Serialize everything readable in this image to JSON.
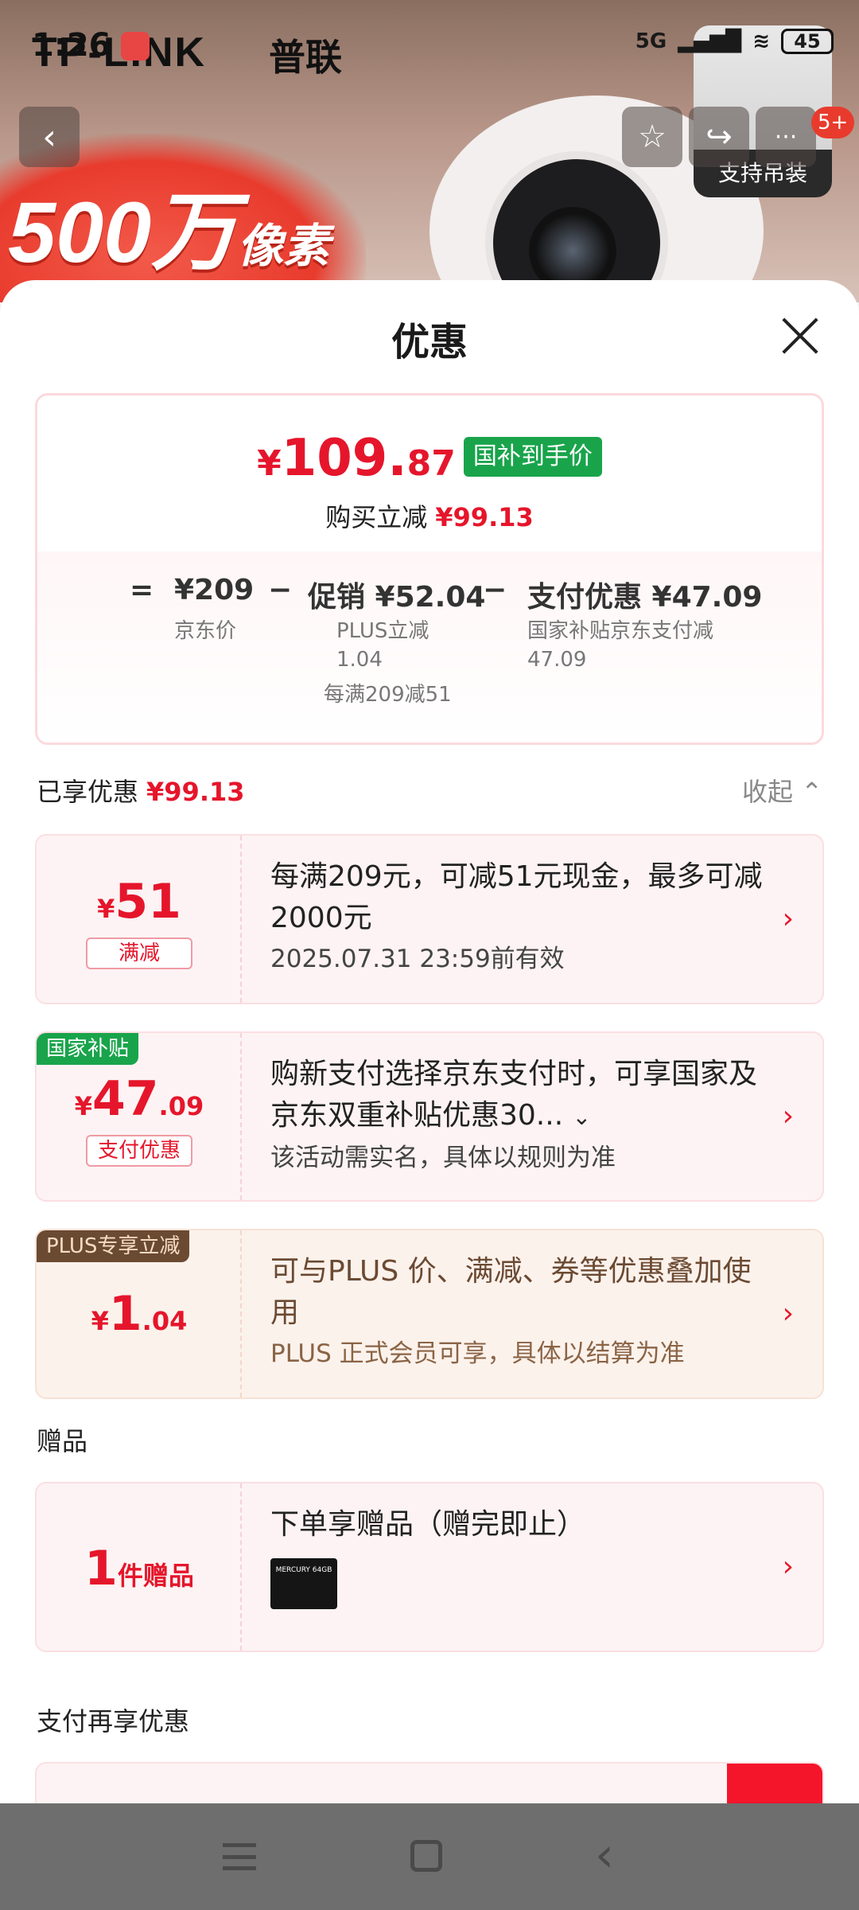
{
  "status_bar": {
    "time": "1:26",
    "network": "5G",
    "battery": "45"
  },
  "background": {
    "brand": "TP-LINK",
    "brand_cn": "普联",
    "promo_big": "500万",
    "promo_small": "像素",
    "thumb_label": "支持吊装",
    "badge": "5+",
    "back_glyph": "‹",
    "more_glyph": "···"
  },
  "sheet": {
    "title": "优惠",
    "price_card": {
      "yen": "¥",
      "price_int": "109.",
      "price_dec": "87",
      "tag": "国补到手价",
      "reduce_label": "购买立减",
      "reduce_value": "¥99.13",
      "formula": {
        "eq": "=",
        "jd_price": "¥209",
        "jd_price_label": "京东价",
        "minus1": "−",
        "promo": "促销 ¥52.04",
        "promo_sub1": "PLUS立减",
        "promo_sub2": "1.04",
        "promo_sub3": "每满209减51",
        "minus2": "−",
        "pay": "支付优惠 ¥47.09",
        "pay_sub1": "国家补贴京东支付减",
        "pay_sub2": "47.09"
      }
    },
    "enjoyed_label": "已享优惠",
    "enjoyed_value": "¥99.13",
    "collapse_label": "收起",
    "coupons": [
      {
        "yen": "¥",
        "int": "51",
        "dec": "",
        "tag": "满减",
        "desc": "每满209元，可减51元现金，最多可减2000元",
        "meta": "2025.07.31 23:59前有效"
      },
      {
        "corner": "国家补贴",
        "yen": "¥",
        "int": "47",
        "dec": ".09",
        "tag": "支付优惠",
        "desc": "购新支付选择京东支付时，可享国家及京东双重补贴优惠30...",
        "meta": "该活动需实名，具体以规则为准"
      },
      {
        "corner": "PLUS专享立减",
        "yen": "¥",
        "int": "1",
        "dec": ".04",
        "desc": "可与PLUS 价、满减、券等优惠叠加使用",
        "meta": "PLUS 正式会员可享，具体以结算为准"
      }
    ],
    "gift_section": "赠品",
    "gift": {
      "count": "1",
      "count_label": "件赠品",
      "desc": "下单享赠品（赠完即止）",
      "img_text": "MERCURY 64GB"
    },
    "pay_section": "支付再享优惠",
    "arrow": "›"
  },
  "colors": {
    "accent": "#e5162b",
    "green": "#19a44b",
    "plus_brown": "#6b4a32"
  }
}
